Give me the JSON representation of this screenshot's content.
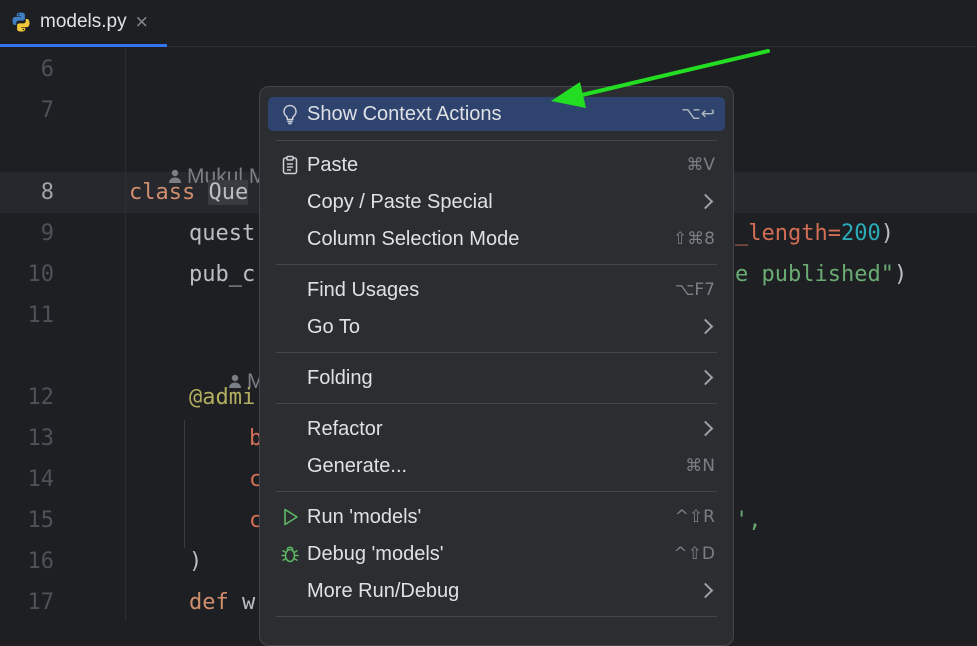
{
  "tab": {
    "file_name": "models.py",
    "close_glyph": "×",
    "icon": "python-icon"
  },
  "gutter": {
    "lines": [
      "6",
      "7",
      "8",
      "9",
      "10",
      "11",
      "12",
      "13",
      "14",
      "15",
      "16",
      "17"
    ]
  },
  "authors": {
    "author_1": "Mukul Ma",
    "author_2": "Muk"
  },
  "code": {
    "line8_kw": "class ",
    "line8_name": "Que",
    "line9_prefix": "quest",
    "line9_suffix_a": "_length=",
    "line9_suffix_b": "200",
    "line9_suffix_c": ")",
    "line10_prefix": "pub_c",
    "line10_str": "e published\"",
    "line10_close": ")",
    "line12": "@admi",
    "line13": "b",
    "line14": "c",
    "line15": "c",
    "line15_tail": "',",
    "line16": ")",
    "line17_kw": "def ",
    "line17_name": "w"
  },
  "context_menu": {
    "show_context_actions": {
      "label": "Show Context Actions",
      "shortcut": "⌥↩",
      "icon": "lightbulb-icon"
    },
    "paste": {
      "label": "Paste",
      "shortcut": "⌘V",
      "icon": "clipboard-icon"
    },
    "copy_paste_special": {
      "label": "Copy / Paste Special"
    },
    "column_selection_mode": {
      "label": "Column Selection Mode",
      "shortcut": "⇧⌘8"
    },
    "find_usages": {
      "label": "Find Usages",
      "shortcut": "⌥F7"
    },
    "go_to": {
      "label": "Go To"
    },
    "folding": {
      "label": "Folding"
    },
    "refactor": {
      "label": "Refactor"
    },
    "generate": {
      "label": "Generate...",
      "shortcut": "⌘N"
    },
    "run": {
      "label": "Run 'models'",
      "shortcut": "^⇧R",
      "icon": "run-icon"
    },
    "debug": {
      "label": "Debug 'models'",
      "shortcut": "^⇧D",
      "icon": "debug-icon"
    },
    "more_run_debug": {
      "label": "More Run/Debug"
    }
  },
  "colors": {
    "background": "#1e1f22",
    "menu_background": "#2b2d30",
    "selection": "#2e436e",
    "annotation_arrow": "#22dd22",
    "keyword": "#cf8e6d",
    "string": "#6aab73",
    "number": "#2aacb8"
  }
}
